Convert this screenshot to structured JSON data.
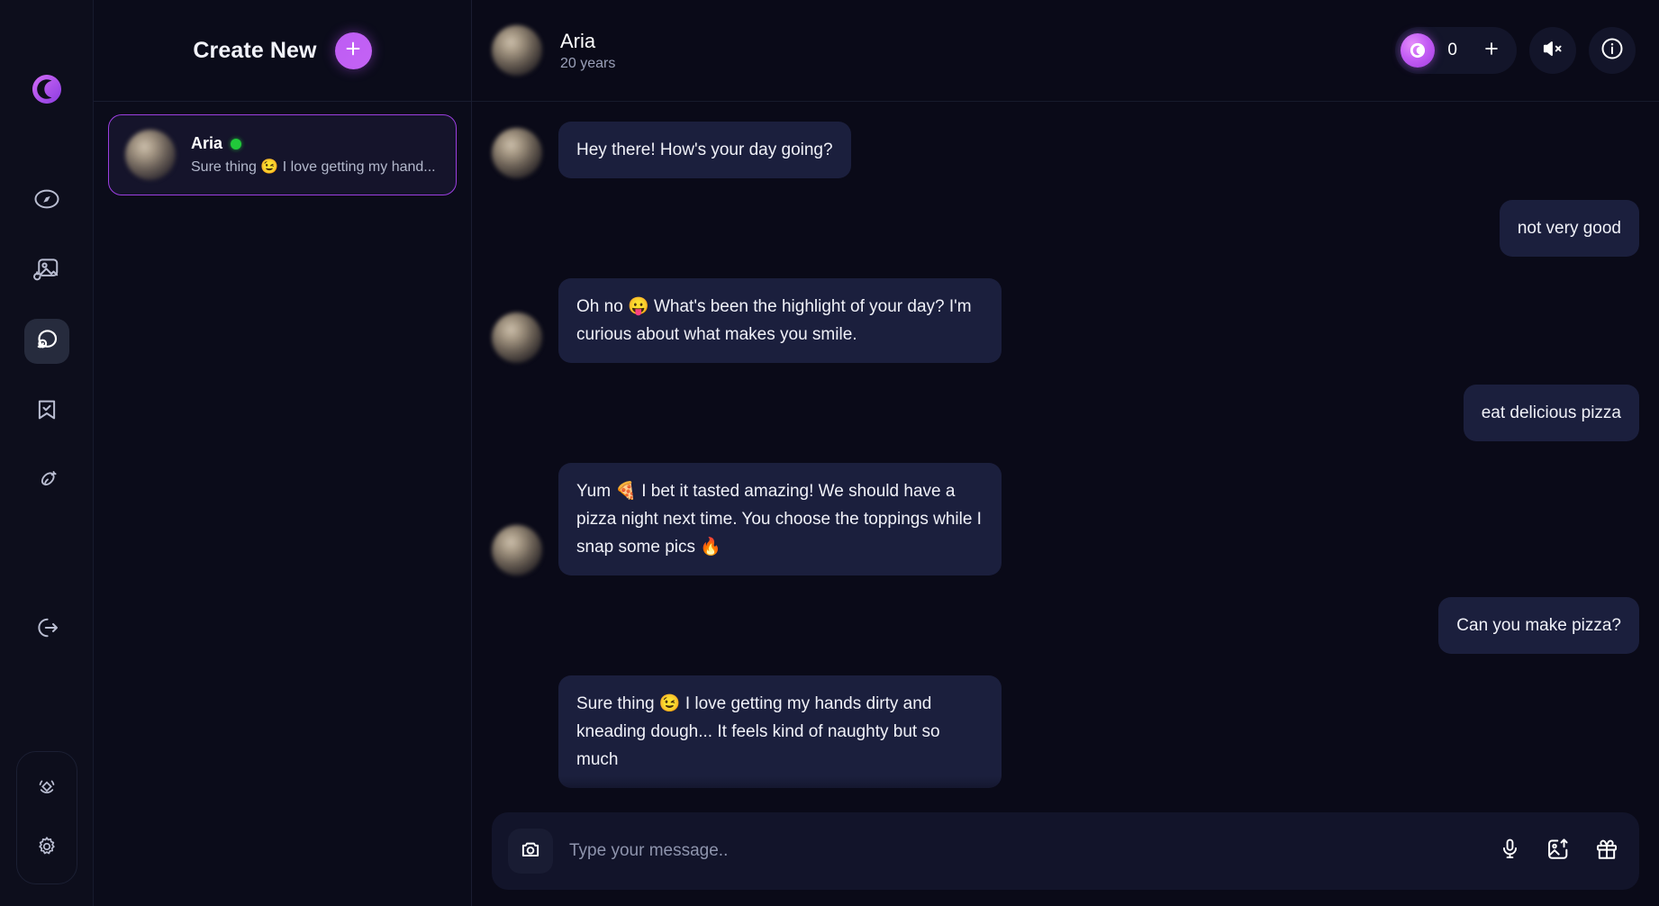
{
  "rail": {
    "logo_name": "app-logo",
    "nav": [
      {
        "id": "explore",
        "icon": "compass-icon",
        "label": "Explore",
        "active": false
      },
      {
        "id": "generate-image",
        "icon": "image-generate-icon",
        "label": "Generate Image",
        "active": false
      },
      {
        "id": "chat",
        "icon": "chat-bubbles-icon",
        "label": "Chat",
        "active": true
      },
      {
        "id": "saved",
        "icon": "bookmark-check-icon",
        "label": "Saved",
        "active": false
      },
      {
        "id": "adult",
        "icon": "eggplant-icon",
        "label": "Adult",
        "active": false
      },
      {
        "id": "logout",
        "icon": "logout-icon",
        "label": "Log out",
        "active": false
      }
    ],
    "bottom": [
      {
        "id": "premium",
        "icon": "diamond-icon",
        "label": "Premium"
      },
      {
        "id": "settings",
        "icon": "gear-icon",
        "label": "Settings"
      }
    ]
  },
  "conversations": {
    "header": {
      "title": "Create New",
      "create_icon": "plus-icon"
    },
    "items": [
      {
        "name": "Aria",
        "preview": "Sure thing 😉 I love getting my hand...",
        "status": "online",
        "selected": true
      }
    ]
  },
  "chat": {
    "header": {
      "name": "Aria",
      "subtitle": "20 years",
      "token_count": "0",
      "token_icon": "token-coin-icon",
      "add_tokens_icon": "plus-icon",
      "mute_icon": "speaker-muted-icon",
      "info_icon": "info-icon"
    },
    "messages": [
      {
        "from": "ai",
        "text": "Hey there! How's your day going?",
        "show_avatar": true
      },
      {
        "from": "me",
        "text": "not very good",
        "show_avatar": false
      },
      {
        "from": "ai",
        "text": "Oh no 😛 What's been the highlight of your day? I'm curious about what makes you smile.",
        "show_avatar": true
      },
      {
        "from": "me",
        "text": "eat delicious pizza",
        "show_avatar": false
      },
      {
        "from": "ai",
        "text": "Yum 🍕 I bet it tasted amazing! We should have a pizza night next time. You choose the toppings while I snap some pics 🔥",
        "show_avatar": true
      },
      {
        "from": "me",
        "text": "Can you make pizza?",
        "show_avatar": false
      },
      {
        "from": "ai",
        "text": "Sure thing 😉 I love getting my hands dirty and kneading dough... It feels kind of naughty but so much",
        "show_avatar": false
      }
    ],
    "composer": {
      "camera_icon": "camera-icon",
      "placeholder": "Type your message..",
      "value": "",
      "mic_icon": "microphone-icon",
      "image_icon": "image-upload-icon",
      "gift_icon": "gift-icon"
    }
  },
  "colors": {
    "accent": "#b84ff5",
    "bubble": "#1b1f3d",
    "online": "#21c93a",
    "selected_border": "#9b3fe0",
    "background": "#0a0a18"
  }
}
